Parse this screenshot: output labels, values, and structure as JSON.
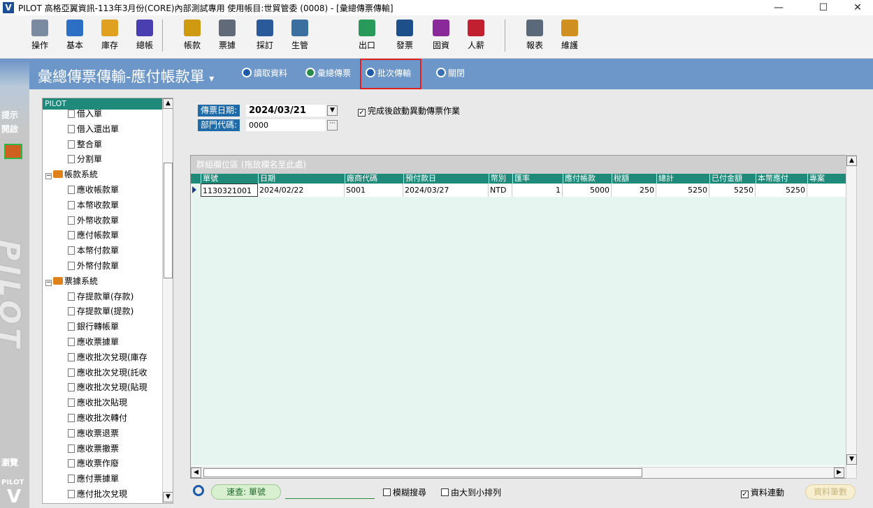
{
  "window": {
    "title": "PILOT 高格亞翼資訊-113年3月份(CORE)內部測試專用 使用帳目:世貿管委 (0008) - [彙總傳票傳輸]",
    "minimize": "—",
    "maximize": "☐",
    "close": "✕"
  },
  "toolbar": [
    {
      "label": "操作",
      "icon": "operate-icon",
      "color": "#7a8aa0"
    },
    {
      "label": "基本",
      "icon": "basic-icon",
      "color": "#2d6fc4"
    },
    {
      "label": "庫存",
      "icon": "inventory-icon",
      "color": "#e0a020"
    },
    {
      "label": "總帳",
      "icon": "ledger-icon",
      "color": "#4a3fb0"
    },
    {
      "label": "帳款",
      "icon": "accounts-icon",
      "color": "#d09a10"
    },
    {
      "label": "票據",
      "icon": "notes-icon",
      "color": "#606a78"
    },
    {
      "label": "採訂",
      "icon": "purchase-icon",
      "color": "#2a5a9a"
    },
    {
      "label": "生管",
      "icon": "production-icon",
      "color": "#3a6fa0"
    },
    {
      "label": "出口",
      "icon": "export-icon",
      "color": "#2a9a5a"
    },
    {
      "label": "發票",
      "icon": "invoice-icon",
      "color": "#1e4f8a"
    },
    {
      "label": "固資",
      "icon": "assets-icon",
      "color": "#8a2a9a"
    },
    {
      "label": "人薪",
      "icon": "payroll-icon",
      "color": "#c02030"
    },
    {
      "label": "報表",
      "icon": "report-icon",
      "color": "#5a6a7a"
    },
    {
      "label": "維護",
      "icon": "maintenance-icon",
      "color": "#d09020"
    }
  ],
  "sidebar": {
    "hint": "提示",
    "open": "開啟",
    "browse": "瀏覽",
    "brand": "PILOT",
    "logo_text": "PILOT"
  },
  "module": {
    "title": "彙總傳票傳輸-應付帳款單",
    "dropdown": "▾",
    "buttons": {
      "read": "讀取資料",
      "summary": "彙總傳票",
      "batch": "批次傳輸",
      "close": "關閉"
    }
  },
  "tree": {
    "root": "PILOT",
    "items": [
      {
        "label": "借入單",
        "type": "doc"
      },
      {
        "label": "借入還出單",
        "type": "doc"
      },
      {
        "label": "整合單",
        "type": "doc"
      },
      {
        "label": "分割單",
        "type": "doc"
      },
      {
        "label": "帳款系統",
        "type": "folder"
      },
      {
        "label": "應收帳款單",
        "type": "doc"
      },
      {
        "label": "本幣收款單",
        "type": "doc"
      },
      {
        "label": "外幣收款單",
        "type": "doc"
      },
      {
        "label": "應付帳款單",
        "type": "doc"
      },
      {
        "label": "本幣付款單",
        "type": "doc"
      },
      {
        "label": "外幣付款單",
        "type": "doc"
      },
      {
        "label": "票據系統",
        "type": "folder"
      },
      {
        "label": "存提款單(存款)",
        "type": "doc"
      },
      {
        "label": "存提款單(提款)",
        "type": "doc"
      },
      {
        "label": "銀行轉帳單",
        "type": "doc"
      },
      {
        "label": "應收票據單",
        "type": "doc"
      },
      {
        "label": "應收批次兌現(庫存",
        "type": "doc"
      },
      {
        "label": "應收批次兌現(託收",
        "type": "doc"
      },
      {
        "label": "應收批次兌現(貼現",
        "type": "doc"
      },
      {
        "label": "應收批次貼現",
        "type": "doc"
      },
      {
        "label": "應收批次轉付",
        "type": "doc"
      },
      {
        "label": "應收票退票",
        "type": "doc"
      },
      {
        "label": "應收票撤票",
        "type": "doc"
      },
      {
        "label": "應收票作廢",
        "type": "doc"
      },
      {
        "label": "應付票據單",
        "type": "doc"
      },
      {
        "label": "應付批次兌現",
        "type": "doc"
      }
    ]
  },
  "form": {
    "date_label": "傳票日期:",
    "date_value": "2024/03/21",
    "dept_label": "部門代碼:",
    "dept_value": "0000",
    "auto_start_label": "完成後啟動異動傳票作業",
    "auto_start_checked": true
  },
  "grid": {
    "group_hint": "群組欄位區 (拖放欄名至此處)",
    "columns": [
      "單號",
      "日期",
      "廠商代碼",
      "預付款日",
      "幣別",
      "匯率",
      "應付帳款",
      "稅額",
      "總計",
      "已付金額",
      "本幣應付",
      "專案"
    ],
    "rows": [
      [
        "1130321001",
        "2024/02/22",
        "S001",
        "2024/03/27",
        "NTD",
        "1",
        "5000",
        "250",
        "5250",
        "5250",
        "5250",
        ""
      ]
    ]
  },
  "bottom": {
    "quick_search": "速查: 單號",
    "fuzzy": "模糊搜尋",
    "sort_desc": "由大到小排列",
    "link_data": "資料連動",
    "link_checked": true,
    "record_count": "資料筆數"
  }
}
